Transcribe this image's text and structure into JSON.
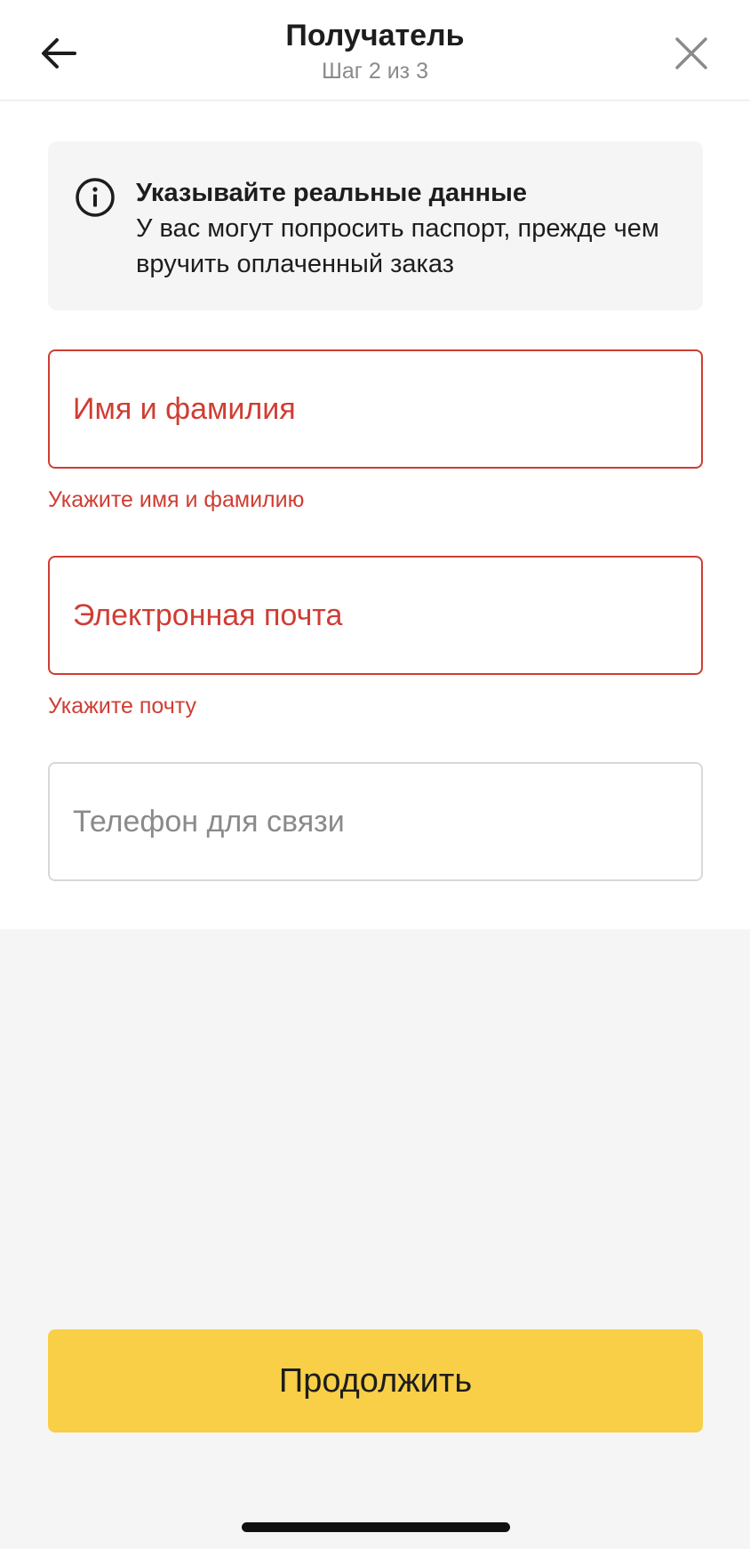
{
  "header": {
    "title": "Получатель",
    "subtitle": "Шаг 2 из 3",
    "back_icon": "arrow-left-icon",
    "close_icon": "close-icon"
  },
  "info": {
    "icon": "info-icon",
    "title": "Указывайте реальные данные",
    "text": "У вас могут попросить паспорт, прежде чем вручить оплаченный заказ"
  },
  "form": {
    "name": {
      "label": "Имя и фамилия",
      "error": "Укажите имя и фамилию",
      "value": ""
    },
    "email": {
      "label": "Электронная почта",
      "error": "Укажите почту",
      "value": ""
    },
    "phone": {
      "label": "Телефон для связи",
      "value": ""
    }
  },
  "footer": {
    "continue_label": "Продолжить"
  },
  "colors": {
    "accent": "#f8cf46",
    "error": "#cf3d33",
    "text": "#1d1d1d",
    "muted": "#8a8a8a",
    "background": "#f5f5f5"
  }
}
